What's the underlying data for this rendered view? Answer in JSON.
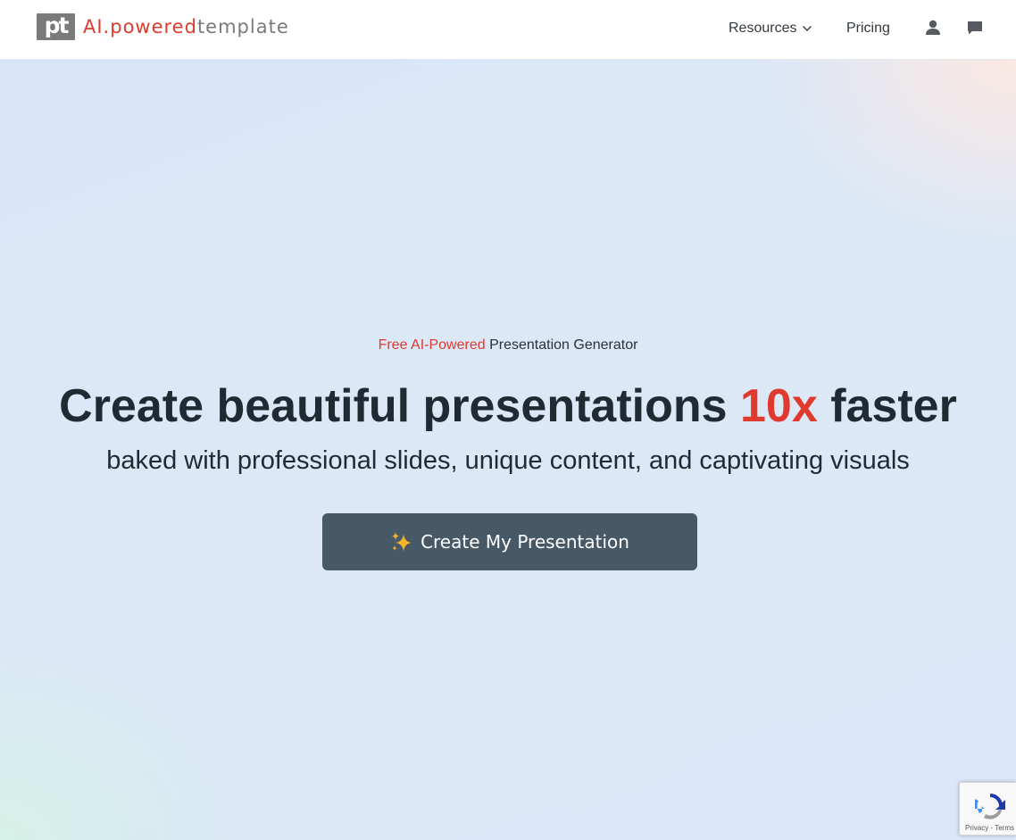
{
  "brand": {
    "mark": "pt",
    "name_part1": "AI.powered",
    "name_part2": "template",
    "accent_color": "#e03a2f",
    "grey_color": "#7a7a7a"
  },
  "nav": {
    "resources_label": "Resources",
    "pricing_label": "Pricing",
    "icons": [
      "user-icon",
      "chat-icon",
      "chevron-down-icon"
    ]
  },
  "hero": {
    "eyebrow_accent": "Free AI-Powered",
    "eyebrow_rest": "Presentation Generator",
    "headline_before": "Create beautiful presentations",
    "headline_accent": "10x",
    "headline_after": "faster",
    "subheadline": "baked with professional slides, unique content, and captivating visuals",
    "cta_label": "Create My Presentation",
    "cta_icon": "sparkles-icon",
    "cta_color": "#475866"
  },
  "recaptcha": {
    "privacy": "Privacy",
    "separator": " - ",
    "terms": "Terms"
  }
}
